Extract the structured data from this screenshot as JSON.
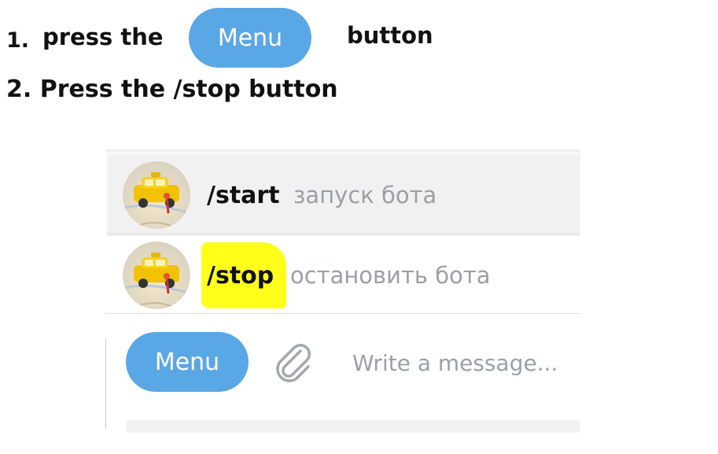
{
  "instructions": {
    "step1_number": "1.",
    "step1_before": "press the",
    "step1_button": "Menu",
    "step1_after": "button",
    "step2": "2. Press the /stop button"
  },
  "commands": [
    {
      "command": "/start",
      "description": "запуск бота",
      "avatar": "taxi-avatar-icon"
    },
    {
      "command": "/stop",
      "description": "остановить бота",
      "avatar": "taxi-avatar-icon",
      "highlighted": true
    }
  ],
  "composer": {
    "menu_label": "Menu",
    "placeholder": "Write a message...",
    "attach_icon": "paperclip-icon"
  },
  "colors": {
    "accent": "#5aa7e6",
    "highlight": "#ffff1a",
    "selected_row": "#f1f1f1"
  }
}
